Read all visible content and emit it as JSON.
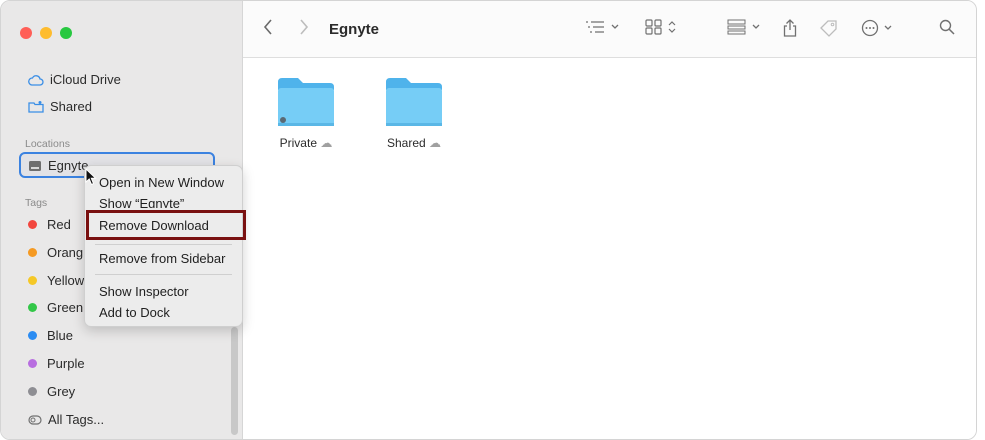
{
  "window": {
    "title": "Egnyte"
  },
  "sidebar": {
    "items_top": [
      {
        "label": "iCloud Drive",
        "icon": "cloud-icon"
      },
      {
        "label": "Shared",
        "icon": "shared-folder-icon"
      }
    ],
    "locations_header": "Locations",
    "locations": [
      {
        "label": "Egnyte",
        "icon": "drive-icon"
      }
    ],
    "tags_header": "Tags",
    "tags": [
      {
        "label": "Red",
        "color": "#f2463e"
      },
      {
        "label": "Orange",
        "color": "#f59a23"
      },
      {
        "label": "Yellow",
        "color": "#f5c827"
      },
      {
        "label": "Green",
        "color": "#33c748"
      },
      {
        "label": "Blue",
        "color": "#2b8cf2"
      },
      {
        "label": "Purple",
        "color": "#b86ee0"
      },
      {
        "label": "Grey",
        "color": "#8e8e93"
      }
    ],
    "tag_visible_labels": [
      "Red",
      "Orang",
      "Yellow",
      "Green",
      "Blue",
      "Purple",
      "Grey"
    ],
    "all_tags": "All Tags..."
  },
  "content": {
    "folders": [
      {
        "name": "Private"
      },
      {
        "name": "Shared"
      }
    ]
  },
  "context_menu": {
    "items": [
      "Open in New Window",
      "Show “Egnyte”",
      "Remove Download",
      "Remove from Sidebar",
      "Show Inspector",
      "Add to Dock"
    ],
    "highlighted": "Remove Download"
  },
  "colors": {
    "close": "#ff5f57",
    "minimize": "#febc2e",
    "zoom": "#28c840",
    "folder": "#6dc8f5",
    "highlight_border": "#7a1111"
  }
}
